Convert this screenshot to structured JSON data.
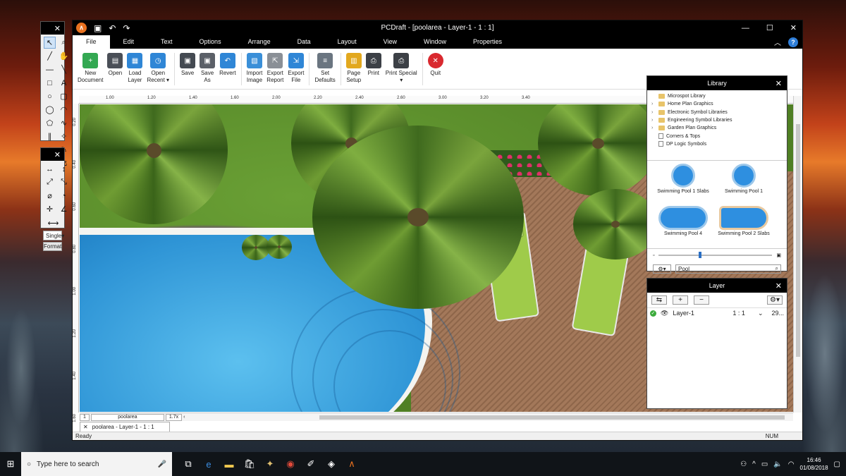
{
  "window": {
    "title": "PCDraft - [poolarea - Layer-1 - 1 : 1]",
    "minimize": "—",
    "maximize": "☐",
    "close": "✕"
  },
  "menu": [
    "File",
    "Edit",
    "Text",
    "Options",
    "Arrange",
    "Data",
    "Layout",
    "View",
    "Window",
    "Properties"
  ],
  "ribbon": [
    {
      "label": "New\nDocument",
      "color": "#33a852",
      "icon": "+"
    },
    {
      "label": "Open",
      "color": "#4a4f57",
      "icon": "▤"
    },
    {
      "label": "Load\nLayer",
      "color": "#2f86d6",
      "icon": "▦"
    },
    {
      "label": "Open\nRecent ▾",
      "color": "#2f86d6",
      "icon": "◷"
    },
    {
      "label": "Save",
      "color": "#444a52",
      "icon": "▣"
    },
    {
      "label": "Save\nAs",
      "color": "#5b6068",
      "icon": "▣"
    },
    {
      "label": "Revert",
      "color": "#2f86d6",
      "icon": "↶"
    },
    {
      "label": "Import\nImage",
      "color": "#3a8fd8",
      "icon": "▧"
    },
    {
      "label": "Export\nReport",
      "color": "#8a8f96",
      "icon": "⇱"
    },
    {
      "label": "Export\nFile",
      "color": "#2f86d6",
      "icon": "⇲"
    },
    {
      "label": "Set\nDefaults",
      "color": "#6a7580",
      "icon": "≡"
    },
    {
      "label": "Page\nSetup",
      "color": "#e2a81e",
      "icon": "▥"
    },
    {
      "label": "Print",
      "color": "#3c4046",
      "icon": "⎙"
    },
    {
      "label": "Print Special\n▾",
      "color": "#3c4046",
      "icon": "⎙"
    },
    {
      "label": "Quit",
      "color": "#d9292f",
      "icon": "✕"
    }
  ],
  "ruler_top": [
    "1.00",
    "1.20",
    "1.40",
    "1.60",
    "2.00",
    "2.20",
    "2.40",
    "2.60",
    "3.00",
    "3.20",
    "3.40"
  ],
  "ruler_left": [
    "0.20",
    "0.40",
    "0.60",
    "0.80",
    "1.00",
    "1.20",
    "1.40",
    "1.60"
  ],
  "document": {
    "page_number": "1",
    "layer_name": "poolarea",
    "zoom": "1.7x",
    "tab_label": "poolarea - Layer-1 - 1 : 1",
    "status_left": "Ready",
    "status_right": "NUM"
  },
  "tool_palette_2": {
    "line_style": "Single",
    "format_button": "Format"
  },
  "library": {
    "title": "Library",
    "tree": [
      {
        "label": "Microspot Library",
        "type": "folder",
        "expand": ""
      },
      {
        "label": "Home Plan Graphics",
        "type": "folder",
        "expand": "›"
      },
      {
        "label": "Electronic Symbol Libraries",
        "type": "folder",
        "expand": "›"
      },
      {
        "label": "Engineering Symbol Libraries",
        "type": "folder",
        "expand": "›"
      },
      {
        "label": "Garden Plan Graphics",
        "type": "folder",
        "expand": "›"
      },
      {
        "label": "Corners & Tops",
        "type": "page",
        "expand": ""
      },
      {
        "label": "DP Logic Symbols",
        "type": "page",
        "expand": ""
      }
    ],
    "symbols": [
      "Swimming Pool 1 Slabs",
      "Swimming Pool 1",
      "Swimming Pool 4",
      "Swimming Pool 2 Slabs"
    ],
    "search_value": "Pool"
  },
  "layer_panel": {
    "title": "Layer",
    "add": "+",
    "remove": "−",
    "rows": [
      {
        "name": "Layer-1",
        "scale": "1 : 1",
        "extra": "29..."
      }
    ]
  },
  "taskbar": {
    "search_placeholder": "Type here to search",
    "time": "16:46",
    "date": "01/08/2018"
  }
}
